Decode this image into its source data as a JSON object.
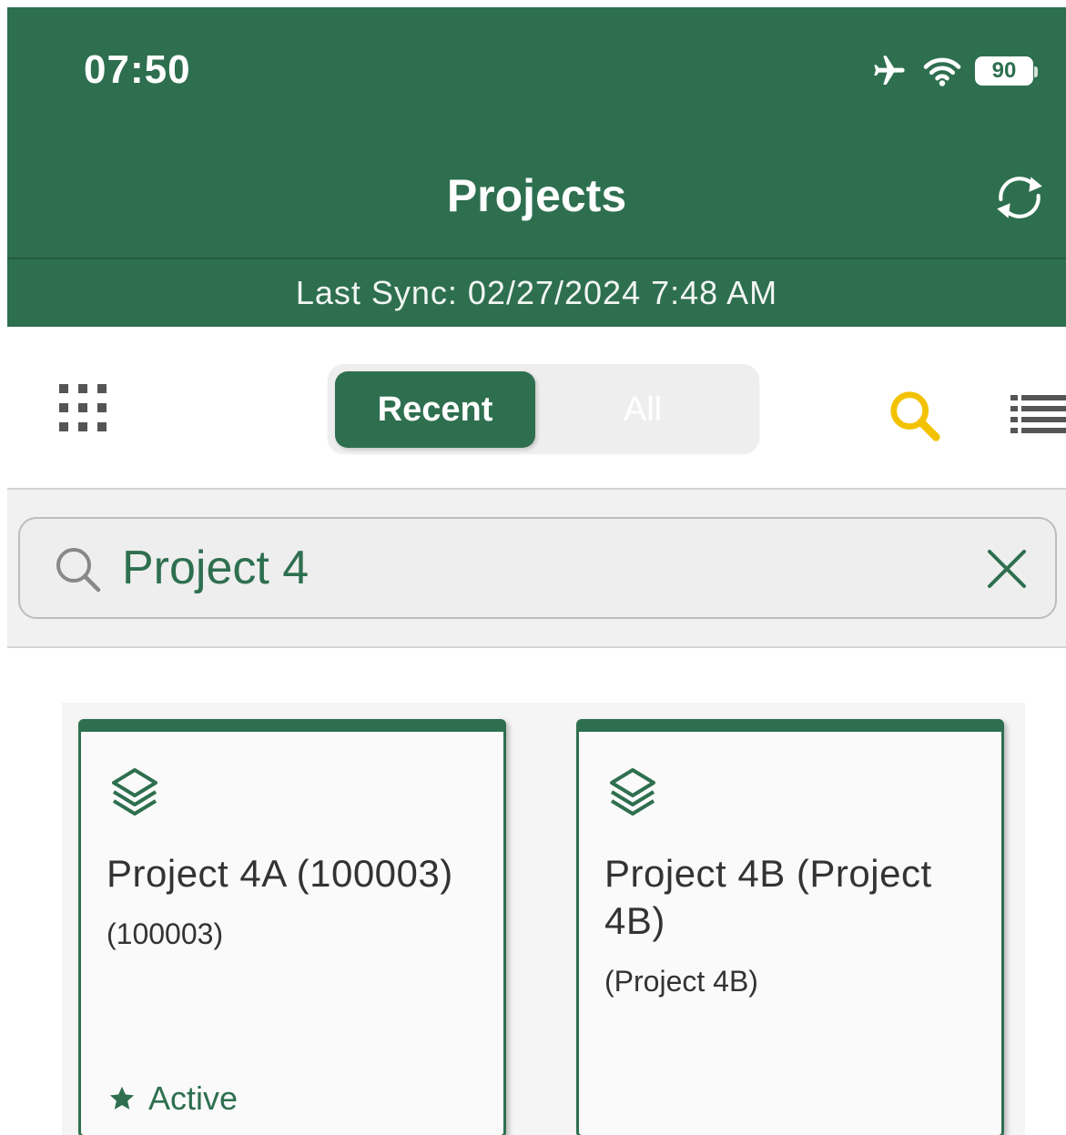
{
  "status_bar": {
    "time": "07:50",
    "battery_level": "90",
    "icons": [
      "airplane-icon",
      "wifi-icon",
      "battery-icon"
    ]
  },
  "header": {
    "title": "Projects",
    "sync_icon": "sync-icon",
    "last_sync": "Last Sync: 02/27/2024 7:48 AM"
  },
  "toolbar": {
    "grid_icon": "grid-icon",
    "tabs": [
      {
        "label": "Recent",
        "active": true
      },
      {
        "label": "All",
        "active": false
      }
    ],
    "search_icon": "search-icon",
    "list_icon": "list-icon"
  },
  "search": {
    "value": "Project 4",
    "clear_icon": "close-icon"
  },
  "projects": [
    {
      "name": "Project 4A (100003)",
      "subtitle": "(100003)",
      "status": "Active",
      "status_icon": "star-icon"
    },
    {
      "name": "Project 4B (Project 4B)",
      "subtitle": "(Project 4B)",
      "status": ""
    }
  ],
  "colors": {
    "brand": "#2e6f4f",
    "search_accent": "#f2c200",
    "icon_gray": "#555555"
  }
}
